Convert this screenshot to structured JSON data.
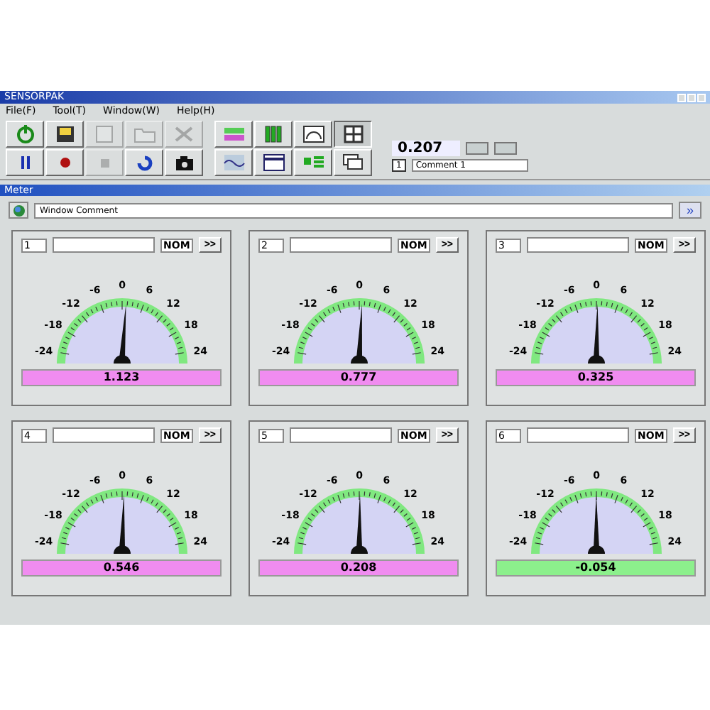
{
  "window": {
    "title": "SENSORPAK"
  },
  "menu": [
    "File(F)",
    "Tool(T)",
    "Window(W)",
    "Help(H)"
  ],
  "toolbar": {
    "rows": [
      [
        {
          "kind": "power",
          "disabled": false
        },
        {
          "kind": "save",
          "disabled": false
        },
        {
          "kind": "open",
          "disabled": true
        },
        {
          "kind": "folder",
          "disabled": true
        },
        {
          "kind": "tools",
          "disabled": true
        }
      ],
      [
        {
          "kind": "pause",
          "disabled": false
        },
        {
          "kind": "record",
          "disabled": false
        },
        {
          "kind": "stop",
          "disabled": true
        },
        {
          "kind": "refresh",
          "disabled": false
        },
        {
          "kind": "camera",
          "disabled": false
        }
      ]
    ],
    "views": [
      [
        {
          "kind": "digital",
          "selected": false
        },
        {
          "kind": "bars",
          "selected": false
        },
        {
          "kind": "meter",
          "selected": false
        },
        {
          "kind": "layout",
          "selected": true
        }
      ],
      [
        {
          "kind": "wave",
          "selected": false
        },
        {
          "kind": "table",
          "selected": false
        },
        {
          "kind": "list",
          "selected": false
        },
        {
          "kind": "windows",
          "selected": false
        }
      ]
    ],
    "reading": "0.207",
    "channel": "1",
    "comment": "Comment 1"
  },
  "meter_window": {
    "title": "Meter",
    "comment": "Window Comment",
    "next_button": "»"
  },
  "meters": [
    {
      "number": "1",
      "nom": "NOM",
      "more": ">>",
      "scale": [
        "-24",
        "-18",
        "-12",
        "-6",
        "0",
        "6",
        "12",
        "18",
        "24"
      ],
      "reading": "1.123",
      "color": "#f08cf0"
    },
    {
      "number": "2",
      "nom": "NOM",
      "more": ">>",
      "scale": [
        "-24",
        "-18",
        "-12",
        "-6",
        "0",
        "6",
        "12",
        "18",
        "24"
      ],
      "reading": "0.777",
      "color": "#f08cf0"
    },
    {
      "number": "3",
      "nom": "NOM",
      "more": ">>",
      "scale": [
        "-24",
        "-18",
        "-12",
        "-6",
        "0",
        "6",
        "12",
        "18",
        "24"
      ],
      "reading": "0.325",
      "color": "#f08cf0"
    },
    {
      "number": "4",
      "nom": "NOM",
      "more": ">>",
      "scale": [
        "-24",
        "-18",
        "-12",
        "-6",
        "0",
        "6",
        "12",
        "18",
        "24"
      ],
      "reading": "0.546",
      "color": "#f08cf0"
    },
    {
      "number": "5",
      "nom": "NOM",
      "more": ">>",
      "scale": [
        "-24",
        "-18",
        "-12",
        "-6",
        "0",
        "6",
        "12",
        "18",
        "24"
      ],
      "reading": "0.208",
      "color": "#f08cf0"
    },
    {
      "number": "6",
      "nom": "NOM",
      "more": ">>",
      "scale": [
        "-24",
        "-18",
        "-12",
        "-6",
        "0",
        "6",
        "12",
        "18",
        "24"
      ],
      "reading": "-0.054",
      "color": "#8cf08c"
    }
  ]
}
